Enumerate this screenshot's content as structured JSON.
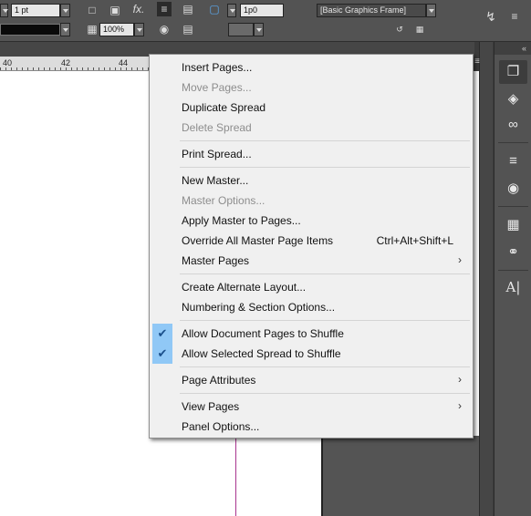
{
  "control_bar": {
    "stroke_weight": "1 pt",
    "opacity": "100%",
    "offset": "1p0",
    "object_style": "[Basic Graphics Frame]",
    "fx_label": "fx."
  },
  "ruler": {
    "ticks": [
      "40",
      "42",
      "44"
    ]
  },
  "dock": {
    "collapse_label": "«",
    "buttons": [
      {
        "name": "pages-icon"
      },
      {
        "name": "layers-icon"
      },
      {
        "name": "links-icon"
      },
      {
        "name": "stroke-icon"
      },
      {
        "name": "swatches-icon"
      },
      {
        "name": "table-icon"
      },
      {
        "name": "cc-libraries-icon"
      },
      {
        "name": "character-styles-icon"
      }
    ]
  },
  "menu": {
    "items": [
      {
        "label": "Insert Pages...",
        "enabled": true
      },
      {
        "label": "Move Pages...",
        "enabled": false
      },
      {
        "label": "Duplicate Spread",
        "enabled": true
      },
      {
        "label": "Delete Spread",
        "enabled": false
      },
      {
        "label": "Print Spread...",
        "enabled": true
      },
      {
        "label": "New Master...",
        "enabled": true
      },
      {
        "label": "Master Options...",
        "enabled": false
      },
      {
        "label": "Apply Master to Pages...",
        "enabled": true
      },
      {
        "label": "Override All Master Page Items",
        "enabled": true,
        "shortcut": "Ctrl+Alt+Shift+L"
      },
      {
        "label": "Master Pages",
        "enabled": true,
        "submenu": true
      },
      {
        "label": "Create Alternate Layout...",
        "enabled": true
      },
      {
        "label": "Numbering & Section Options...",
        "enabled": true
      },
      {
        "label": "Allow Document Pages to Shuffle",
        "enabled": true,
        "checked": true
      },
      {
        "label": "Allow Selected Spread to Shuffle",
        "enabled": true,
        "checked": true
      },
      {
        "label": "Page Attributes",
        "enabled": true,
        "submenu": true
      },
      {
        "label": "View Pages",
        "enabled": true,
        "submenu": true
      },
      {
        "label": "Panel Options...",
        "enabled": true
      }
    ],
    "check_glyph": "✔",
    "arrow_glyph": "›"
  }
}
